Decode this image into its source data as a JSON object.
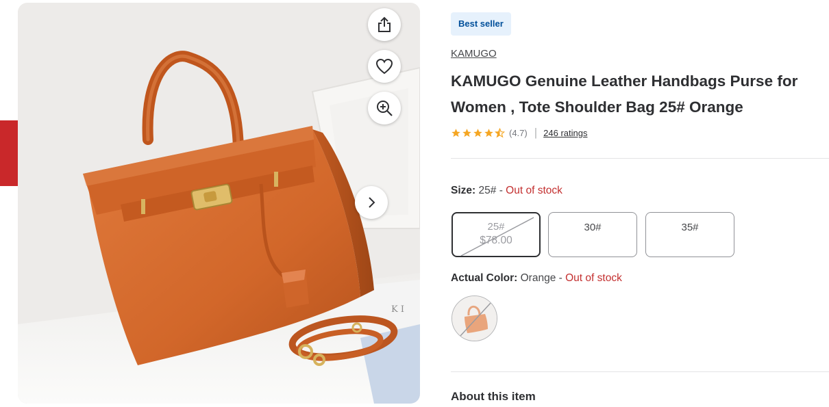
{
  "product": {
    "badge": "Best seller",
    "brand": "KAMUGO",
    "title": "KAMUGO Genuine Leather Handbags Purse for Women , Tote Shoulder Bag 25# Orange",
    "rating_value": "(4.7)",
    "rating_stars": 4.7,
    "ratings_count_label": "246 ratings"
  },
  "size": {
    "label": "Size:",
    "selected": "25#",
    "separator": "-",
    "status": "Out of stock",
    "options": [
      {
        "label": "25#",
        "price": "$78.00",
        "selected": true,
        "available": false
      },
      {
        "label": "30#",
        "selected": false,
        "available": true
      },
      {
        "label": "35#",
        "selected": false,
        "available": true
      }
    ]
  },
  "color": {
    "label": "Actual Color:",
    "selected": "Orange",
    "separator": "-",
    "status": "Out of stock"
  },
  "about": {
    "heading": "About this item"
  },
  "icons": {
    "share_tab": "share-icon",
    "share": "share-upload-icon",
    "favorite": "heart-icon",
    "zoom": "zoom-in-icon",
    "next": "chevron-right-icon",
    "star": "star-icon"
  },
  "colors": {
    "accent_red": "#c9282a",
    "badge_bg": "#e6f1fc",
    "badge_text": "#004f9a",
    "star": "#ffc220",
    "out_of_stock": "#c32f2f"
  }
}
